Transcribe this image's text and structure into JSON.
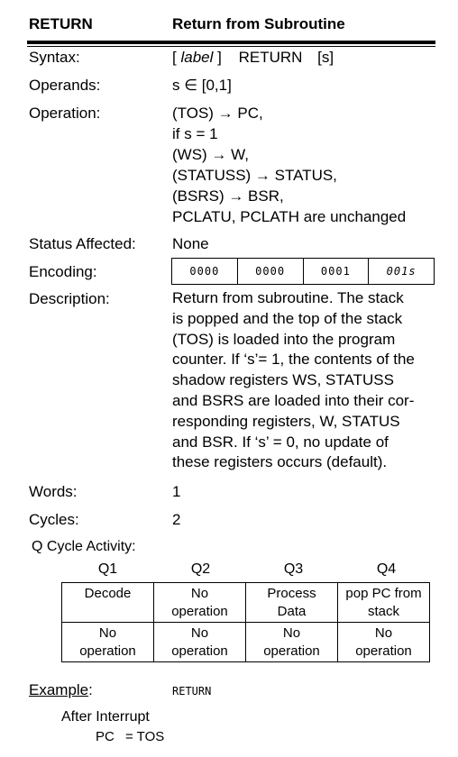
{
  "header": {
    "mnemonic": "RETURN",
    "title": "Return from Subroutine"
  },
  "syntax": {
    "label": "Syntax:",
    "open": "[",
    "label_italic": "label",
    "close": "]",
    "instr": "RETURN",
    "arg": "[s]"
  },
  "operands": {
    "label": "Operands:",
    "value": "s ∈ [0,1]"
  },
  "operation": {
    "label": "Operation:",
    "lines": [
      "(TOS) → PC,",
      "if s = 1",
      "(WS) → W,",
      "(STATUSS) → STATUS,",
      "(BSRS) → BSR,",
      "PCLATU, PCLATH are unchanged"
    ]
  },
  "status": {
    "label": "Status Affected:",
    "value": "None"
  },
  "encoding": {
    "label": "Encoding:",
    "fields": [
      "0000",
      "0000",
      "0001",
      "001s"
    ]
  },
  "description": {
    "label": "Description:",
    "lines": [
      "Return from subroutine. The stack",
      "is popped and the top of the stack",
      "(TOS) is loaded into the program",
      "counter. If ‘s’= 1, the contents of the",
      "shadow registers WS, STATUSS",
      "and BSRS are loaded into their cor-",
      "responding registers, W, STATUS",
      "and BSR. If ‘s’ = 0, no update of",
      "these registers occurs (default)."
    ]
  },
  "words": {
    "label": "Words:",
    "value": "1"
  },
  "cycles": {
    "label": "Cycles:",
    "value": "2"
  },
  "q_cycle": {
    "label": "Q Cycle Activity:",
    "headers": [
      "Q1",
      "Q2",
      "Q3",
      "Q4"
    ],
    "rows": [
      [
        [
          "Decode"
        ],
        [
          "No",
          "operation"
        ],
        [
          "Process",
          "Data"
        ],
        [
          "pop PC from",
          "stack"
        ]
      ],
      [
        [
          "No",
          "operation"
        ],
        [
          "No",
          "operation"
        ],
        [
          "No",
          "operation"
        ],
        [
          "No",
          "operation"
        ]
      ]
    ]
  },
  "example": {
    "label": "Example",
    "colon": ":",
    "code": "RETURN",
    "after": "After Interrupt",
    "result_reg": "PC",
    "result_val": "= TOS"
  }
}
